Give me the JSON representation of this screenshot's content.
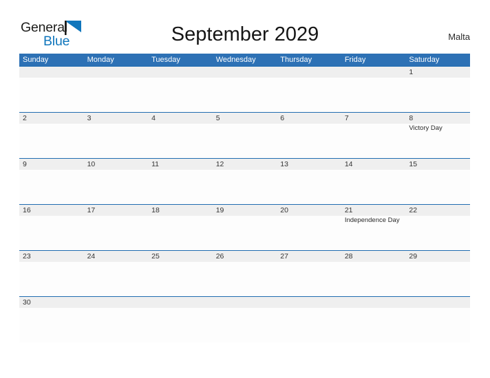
{
  "brand": {
    "name_part1": "General",
    "name_part2": "Blue",
    "flag_icon": "blue-triangle-flag-icon",
    "color_dark": "#1d1d1b",
    "color_blue": "#1076bc"
  },
  "header": {
    "title": "September 2029",
    "region": "Malta",
    "header_bg": "#2d71b5",
    "row_border": "#1f6bb0",
    "band_bg": "#efefef"
  },
  "calendar": {
    "day_names": [
      "Sunday",
      "Monday",
      "Tuesday",
      "Wednesday",
      "Thursday",
      "Friday",
      "Saturday"
    ],
    "weeks": [
      [
        {
          "day": "",
          "event": ""
        },
        {
          "day": "",
          "event": ""
        },
        {
          "day": "",
          "event": ""
        },
        {
          "day": "",
          "event": ""
        },
        {
          "day": "",
          "event": ""
        },
        {
          "day": "",
          "event": ""
        },
        {
          "day": "1",
          "event": ""
        }
      ],
      [
        {
          "day": "2",
          "event": ""
        },
        {
          "day": "3",
          "event": ""
        },
        {
          "day": "4",
          "event": ""
        },
        {
          "day": "5",
          "event": ""
        },
        {
          "day": "6",
          "event": ""
        },
        {
          "day": "7",
          "event": ""
        },
        {
          "day": "8",
          "event": "Victory Day"
        }
      ],
      [
        {
          "day": "9",
          "event": ""
        },
        {
          "day": "10",
          "event": ""
        },
        {
          "day": "11",
          "event": ""
        },
        {
          "day": "12",
          "event": ""
        },
        {
          "day": "13",
          "event": ""
        },
        {
          "day": "14",
          "event": ""
        },
        {
          "day": "15",
          "event": ""
        }
      ],
      [
        {
          "day": "16",
          "event": ""
        },
        {
          "day": "17",
          "event": ""
        },
        {
          "day": "18",
          "event": ""
        },
        {
          "day": "19",
          "event": ""
        },
        {
          "day": "20",
          "event": ""
        },
        {
          "day": "21",
          "event": "Independence Day"
        },
        {
          "day": "22",
          "event": ""
        }
      ],
      [
        {
          "day": "23",
          "event": ""
        },
        {
          "day": "24",
          "event": ""
        },
        {
          "day": "25",
          "event": ""
        },
        {
          "day": "26",
          "event": ""
        },
        {
          "day": "27",
          "event": ""
        },
        {
          "day": "28",
          "event": ""
        },
        {
          "day": "29",
          "event": ""
        }
      ],
      [
        {
          "day": "30",
          "event": ""
        },
        {
          "day": "",
          "event": ""
        },
        {
          "day": "",
          "event": ""
        },
        {
          "day": "",
          "event": ""
        },
        {
          "day": "",
          "event": ""
        },
        {
          "day": "",
          "event": ""
        },
        {
          "day": "",
          "event": ""
        }
      ]
    ]
  }
}
